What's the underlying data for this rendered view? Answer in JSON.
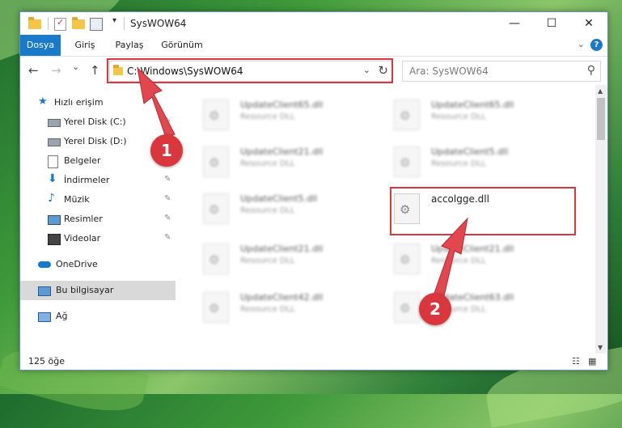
{
  "window": {
    "title": "SysWOW64",
    "minimize": "—",
    "maximize": "☐",
    "close": "✕"
  },
  "ribbon": {
    "tabs": [
      {
        "label": "Dosya",
        "active": true
      },
      {
        "label": "Giriş"
      },
      {
        "label": "Paylaş"
      },
      {
        "label": "Görünüm"
      }
    ],
    "help": "?",
    "collapse": "⌄"
  },
  "nav": {
    "back": "←",
    "forward": "→",
    "recent": "⌄",
    "up": "↑",
    "address": "C:\\Windows\\SysWOW64",
    "address_dropdown": "⌄",
    "refresh": "↻",
    "search_placeholder": "Ara: SysWOW64",
    "search_icon": "⚲"
  },
  "sidebar": {
    "items": [
      {
        "label": "Hızlı erişim",
        "icon": "star-icon",
        "pinned": false
      },
      {
        "label": "Yerel Disk (C:)",
        "icon": "drive-icon",
        "pinned": true
      },
      {
        "label": "Yerel Disk (D:)",
        "icon": "drive-icon",
        "pinned": false
      },
      {
        "label": "Belgeler",
        "icon": "document-icon",
        "pinned": true
      },
      {
        "label": "İndirmeler",
        "icon": "download-icon",
        "pinned": true
      },
      {
        "label": "Müzik",
        "icon": "music-icon",
        "pinned": true
      },
      {
        "label": "Resimler",
        "icon": "pictures-icon",
        "pinned": true
      },
      {
        "label": "Videolar",
        "icon": "video-icon",
        "pinned": true
      },
      {
        "label": "OneDrive",
        "icon": "cloud-icon",
        "pinned": false
      },
      {
        "label": "Bu bilgisayar",
        "icon": "computer-icon",
        "pinned": false,
        "selected": true
      },
      {
        "label": "Ağ",
        "icon": "network-icon",
        "pinned": false
      }
    ],
    "pin_glyph": "📌"
  },
  "files": [
    {
      "name": "UpdateClient65.dll",
      "desc": "Resource DLL"
    },
    {
      "name": "UpdateClient65.dll",
      "desc": "Resource DLL"
    },
    {
      "name": "UpdateClient21.dll",
      "desc": "Resource DLL"
    },
    {
      "name": "UpdateClient5.dll",
      "desc": "Resource DLL"
    },
    {
      "name": "UpdateClient5.dll",
      "desc": "Resource DLL"
    },
    {
      "name": "accolgge.dll",
      "desc": ""
    },
    {
      "name": "UpdateClient21.dll",
      "desc": "Resource DLL"
    },
    {
      "name": "UpdateClient21.dll",
      "desc": "Resource DLL"
    },
    {
      "name": "UpdateClient42.dll",
      "desc": "Resource DLL"
    },
    {
      "name": "UpdateClient63.dll",
      "desc": "Resource DLL"
    }
  ],
  "status": {
    "count": "125 öğe"
  },
  "callouts": {
    "one": "1",
    "two": "2"
  },
  "colors": {
    "accent": "#1979ca",
    "highlight": "#d9363e"
  }
}
